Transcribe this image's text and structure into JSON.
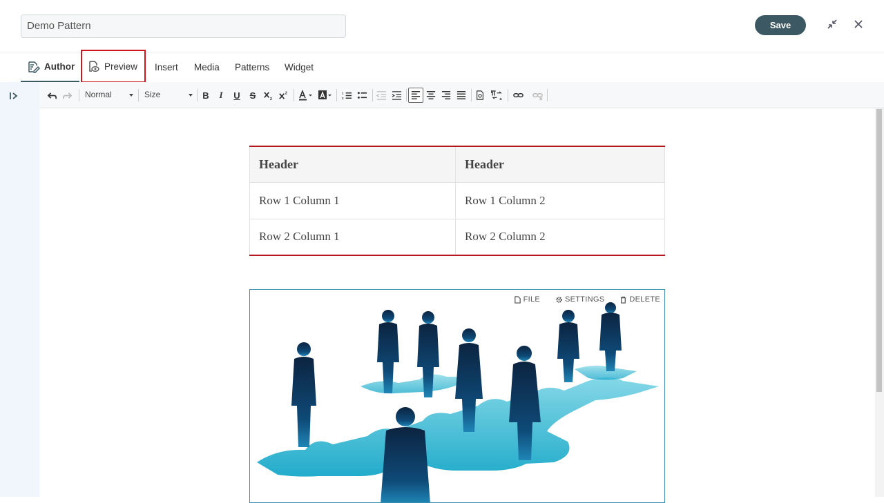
{
  "header": {
    "title_value": "Demo Pattern",
    "save_label": "Save"
  },
  "tabs": [
    {
      "label": "Author"
    },
    {
      "label": "Preview"
    },
    {
      "label": "Insert"
    },
    {
      "label": "Media"
    },
    {
      "label": "Patterns"
    },
    {
      "label": "Widget"
    }
  ],
  "toolbar": {
    "format_value": "Normal",
    "size_value": "Size",
    "bold": "B",
    "italic": "I",
    "underline": "U",
    "strike": "S"
  },
  "table": {
    "headers": [
      "Header",
      "Header"
    ],
    "rows": [
      [
        "Row 1 Column 1",
        "Row 1 Column 2"
      ],
      [
        "Row 2 Column 1",
        "Row 2 Column 2"
      ]
    ]
  },
  "image_actions": {
    "file": "FILE",
    "settings": "SETTINGS",
    "delete": "DELETE"
  },
  "colors": {
    "accent": "#3c5963",
    "table_rule": "#b3161d",
    "highlight": "#d0161c"
  }
}
